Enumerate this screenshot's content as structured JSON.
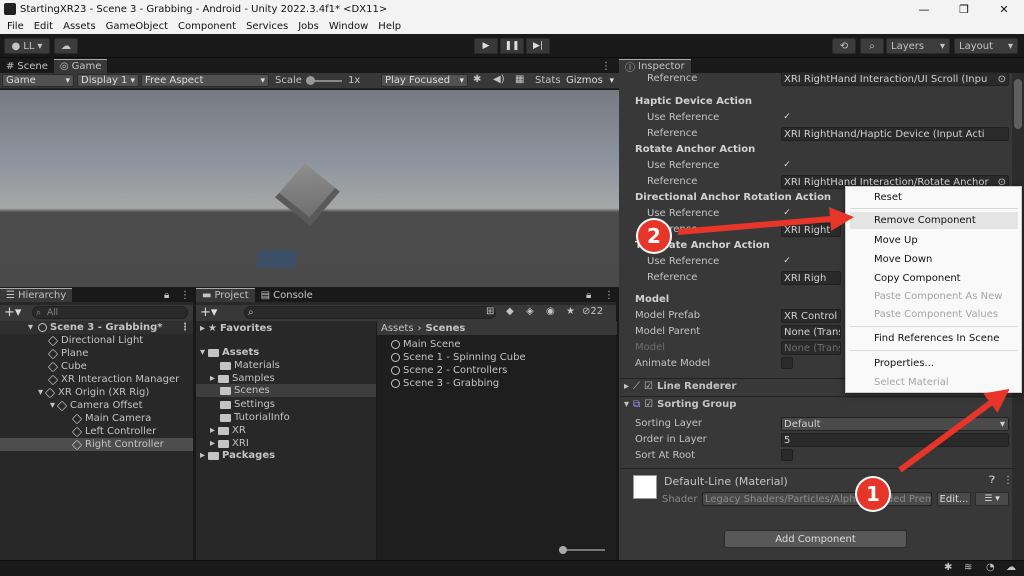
{
  "window": {
    "title": "StartingXR23 - Scene 3 - Grabbing - Android - Unity 2022.3.4f1* <DX11>"
  },
  "menu": [
    "File",
    "Edit",
    "Assets",
    "GameObject",
    "Component",
    "Services",
    "Jobs",
    "Window",
    "Help"
  ],
  "toolbar": {
    "account": "LL",
    "layers": "Layers",
    "layout": "Layout"
  },
  "scene_tabs": {
    "scene": "Scene",
    "game": "Game"
  },
  "gamebar": {
    "mode": "Game",
    "display": "Display 1",
    "aspect": "Free Aspect",
    "scale_label": "Scale",
    "scale_value": "1x",
    "play_focused": "Play Focused",
    "stats": "Stats",
    "gizmos": "Gizmos"
  },
  "hierarchy": {
    "title": "Hierarchy",
    "search": "All",
    "items": [
      {
        "label": "Scene 3 - Grabbing*",
        "icon": "scene-icon"
      },
      {
        "label": "Directional Light",
        "icon": "gameobject-icon"
      },
      {
        "label": "Plane",
        "icon": "gameobject-icon"
      },
      {
        "label": "Cube",
        "icon": "gameobject-icon"
      },
      {
        "label": "XR Interaction Manager",
        "icon": "gameobject-icon"
      },
      {
        "label": "XR Origin (XR Rig)",
        "icon": "gameobject-icon"
      },
      {
        "label": "Camera Offset",
        "icon": "gameobject-icon"
      },
      {
        "label": "Main Camera",
        "icon": "gameobject-icon"
      },
      {
        "label": "Left Controller",
        "icon": "gameobject-icon"
      },
      {
        "label": "Right Controller",
        "icon": "gameobject-icon"
      }
    ]
  },
  "project": {
    "tab_project": "Project",
    "tab_console": "Console",
    "badge": "22",
    "favorites": "Favorites",
    "assets": "Assets",
    "folders": [
      "Materials",
      "Samples",
      "Scenes",
      "Settings",
      "TutorialInfo",
      "XR",
      "XRI"
    ],
    "packages": "Packages",
    "breadcrumb": [
      "Assets",
      "Scenes"
    ],
    "files": [
      "Main Scene",
      "Scene 1 - Spinning Cube",
      "Scene 2 - Controllers",
      "Scene 3 - Grabbing"
    ]
  },
  "inspector": {
    "title": "Inspector",
    "reference_label": "Reference",
    "use_reference_label": "Use Reference",
    "ref0": "XRI RightHand Interaction/UI Scroll (Inpu",
    "haptic": {
      "header": "Haptic Device Action",
      "ref": "XRI RightHand/Haptic Device (Input Acti"
    },
    "rotate": {
      "header": "Rotate Anchor Action",
      "ref": "XRI RightHand Interaction/Rotate Anchor"
    },
    "dir_rot": {
      "header": "Directional Anchor Rotation Action",
      "ref": "XRI Right"
    },
    "translate": {
      "header": "Translate Anchor Action",
      "ref": "XRI Righ"
    },
    "model": {
      "header": "Model",
      "prefab_label": "Model Prefab",
      "prefab_value": "XR Control",
      "parent_label": "Model Parent",
      "parent_value": "None (Transf",
      "model_label": "Model",
      "model_value": "None (Transf",
      "animate_label": "Animate Model"
    },
    "line_renderer": "Line Renderer",
    "sorting_group": {
      "title": "Sorting Group",
      "layer_label": "Sorting Layer",
      "layer_value": "Default",
      "order_label": "Order in Layer",
      "order_value": "5",
      "root_label": "Sort At Root"
    },
    "material": {
      "name": "Default-Line (Material)",
      "shader_label": "Shader",
      "shader_value": "Legacy Shaders/Particles/Alpha Blended Prem",
      "edit": "Edit..."
    },
    "add_component": "Add Component"
  },
  "context_menu": {
    "items": [
      {
        "label": "Reset",
        "enabled": true
      },
      {
        "label": "Remove Component",
        "enabled": true,
        "highlighted": true
      },
      {
        "label": "Move Up",
        "enabled": true
      },
      {
        "label": "Move Down",
        "enabled": true
      },
      {
        "label": "Copy Component",
        "enabled": true
      },
      {
        "label": "Paste Component As New",
        "enabled": false
      },
      {
        "label": "Paste Component Values",
        "enabled": false
      },
      {
        "label": "Find References In Scene",
        "enabled": true
      },
      {
        "label": "Properties...",
        "enabled": true
      },
      {
        "label": "Select Material",
        "enabled": false
      }
    ]
  },
  "annotations": {
    "marker1": "1",
    "marker2": "2",
    "arrow_color": "#e8352a"
  }
}
